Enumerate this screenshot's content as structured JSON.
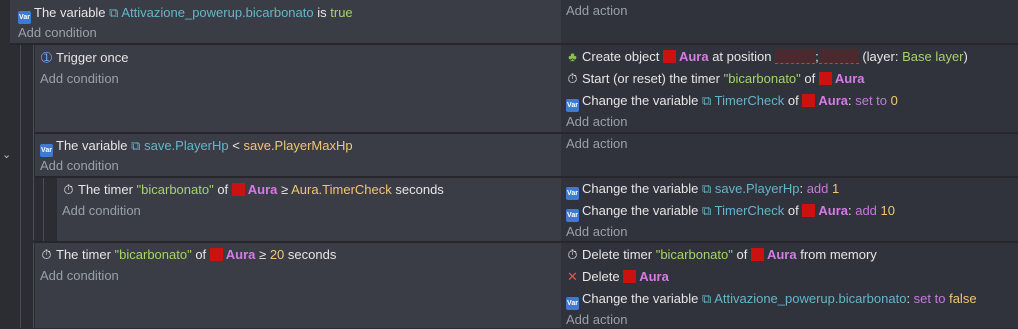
{
  "icons": {
    "variable": "variable-icon",
    "timer": "stopwatch-icon",
    "trigger": "trigger-once-icon",
    "create": "create-object-icon",
    "delete": "delete-x-icon",
    "var_ref": "variable-ref-icon",
    "obj_var": "object-variable-icon"
  },
  "colors": {
    "object_square": "#cc1111",
    "object_name": "#d77ae8",
    "string": "#a6d36a",
    "variable": "#63b6c9",
    "value": "#f0c674"
  },
  "common": {
    "add_condition": "Add condition",
    "add_action": "Add action",
    "aura": "Aura",
    "the_variable": "The variable",
    "change_the_variable": "Change the variable",
    "of": "of",
    "seconds": "seconds",
    "the_timer": "The timer"
  },
  "e1": {
    "var": "Attivazione_powerup.bicarbonato",
    "is": "is",
    "value": "true"
  },
  "e2": {
    "trigger": "Trigger once",
    "a1_pre": "Create object",
    "a1_mid": "at position",
    "a1_sep": ";",
    "a1_post": "(layer:",
    "a1_layer": "Base layer",
    "a1_close": ")",
    "a2_pre": "Start (or reset) the timer",
    "a2_timer": "\"bicarbonato\"",
    "a3_var": "TimerCheck",
    "a3_op": "set to",
    "a3_val": "0"
  },
  "e3": {
    "var": "save.PlayerHp",
    "cmp": "<",
    "rhs": "save.PlayerMaxHp"
  },
  "e4": {
    "timer": "\"bicarbonato\"",
    "cmp": "≥",
    "rhs": "Aura.TimerCheck",
    "a1_var": "save.PlayerHp",
    "a1_op": "add",
    "a1_val": "1",
    "a2_var": "TimerCheck",
    "a2_op": "add",
    "a2_val": "10"
  },
  "e5": {
    "timer": "\"bicarbonato\"",
    "cmp": "≥",
    "val": "20",
    "a1_pre": "Delete timer",
    "a1_timer": "\"bicarbonato\"",
    "a1_post": "from memory",
    "a2_pre": "Delete",
    "a3_var": "Attivazione_powerup.bicarbonato",
    "a3_op": "set to",
    "a3_val": "false"
  }
}
